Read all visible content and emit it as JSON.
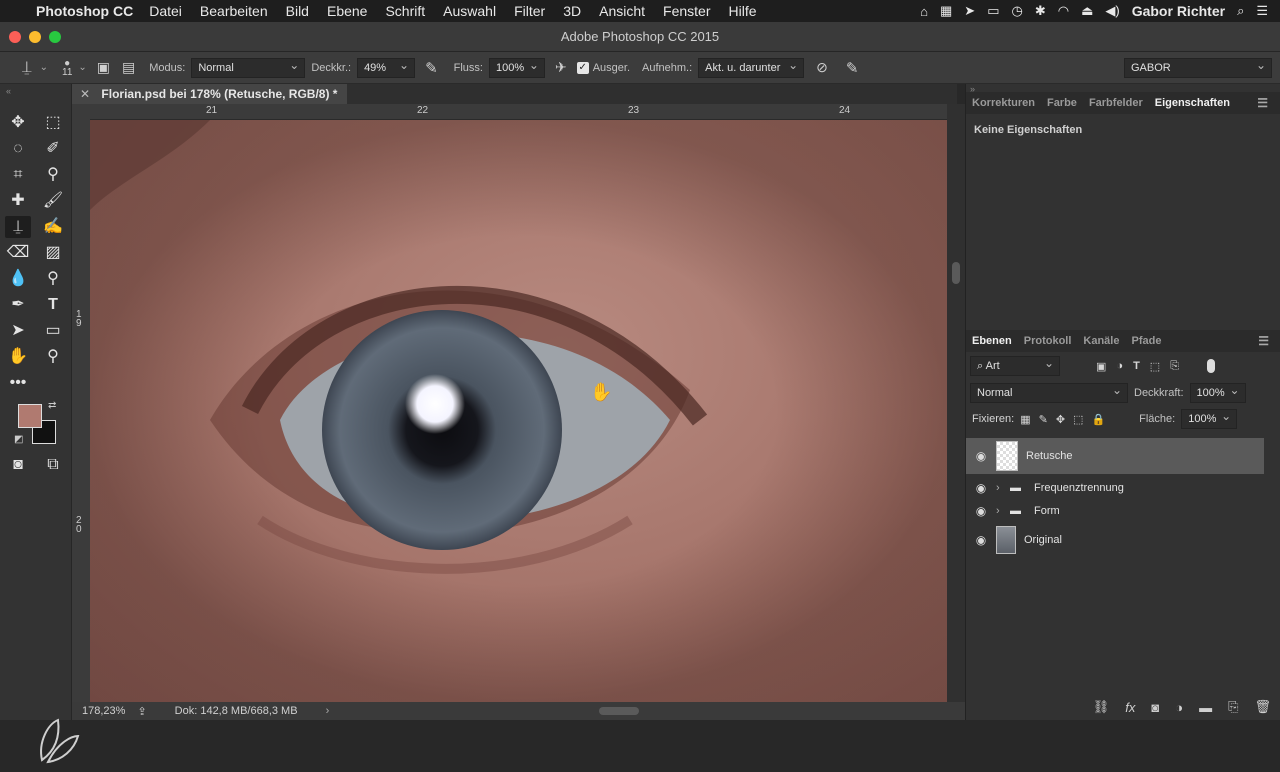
{
  "menubar": {
    "app_name": "Photoshop CC",
    "items": [
      "Datei",
      "Bearbeiten",
      "Bild",
      "Ebene",
      "Schrift",
      "Auswahl",
      "Filter",
      "3D",
      "Ansicht",
      "Fenster",
      "Hilfe"
    ],
    "user": "Gabor Richter"
  },
  "window": {
    "title": "Adobe Photoshop CC 2015"
  },
  "options": {
    "brush_size": "11",
    "mode_label": "Modus:",
    "mode_value": "Normal",
    "opacity_label": "Deckkr.:",
    "opacity_value": "49%",
    "flow_label": "Fluss:",
    "flow_value": "100%",
    "aligned_label": "Ausger.",
    "sample_label": "Aufnehm.:",
    "sample_value": "Akt. u. darunter",
    "workspace": "GABOR"
  },
  "document": {
    "tab_title": "Florian.psd bei 178% (Retusche, RGB/8) *",
    "ruler_top": [
      "21",
      "22",
      "23",
      "24"
    ],
    "ruler_left": [
      "1\n9",
      "2\n0"
    ]
  },
  "status": {
    "zoom": "178,23%",
    "doc": "Dok: 142,8 MB/668,3 MB"
  },
  "colors": {
    "foreground": "#b07a70",
    "background": "#111111"
  },
  "panel_top": {
    "tabs": [
      "Korrekturen",
      "Farbe",
      "Farbfelder",
      "Eigenschaften"
    ],
    "active_tab": "Eigenschaften",
    "message": "Keine Eigenschaften"
  },
  "layers_panel": {
    "tabs": [
      "Ebenen",
      "Protokoll",
      "Kanäle",
      "Pfade"
    ],
    "active_tab": "Ebenen",
    "filter": "Art",
    "blend_mode": "Normal",
    "opacity_label": "Deckkraft:",
    "opacity_value": "100%",
    "lock_label": "Fixieren:",
    "fill_label": "Fläche:",
    "fill_value": "100%",
    "layers": [
      {
        "name": "Retusche",
        "selected": true
      },
      {
        "name": "Frequenztrennung",
        "group": true
      },
      {
        "name": "Form",
        "group": true
      },
      {
        "name": "Original"
      }
    ]
  }
}
